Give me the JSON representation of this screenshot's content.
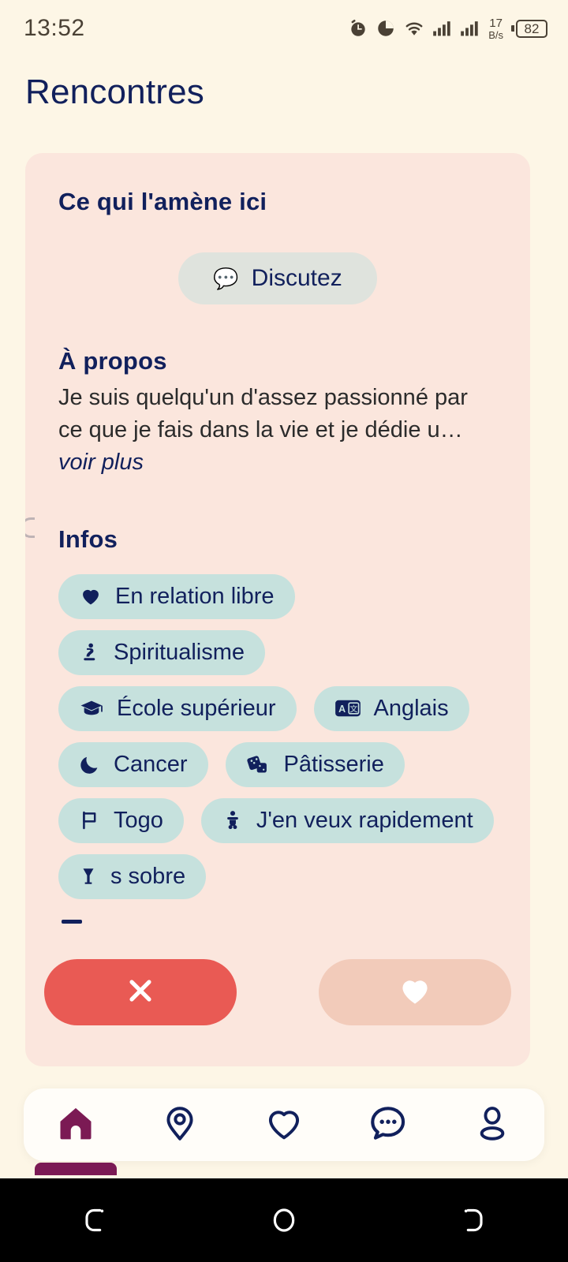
{
  "status_bar": {
    "time": "13:52",
    "network_speed_value": "17",
    "network_speed_unit": "B/s",
    "battery_level": "82",
    "icons": [
      "alarm-icon",
      "pie-chart-icon",
      "wifi-icon",
      "signal-bars-icon",
      "signal-bars-icon",
      "battery-icon"
    ]
  },
  "header": {
    "title": "Rencontres"
  },
  "card": {
    "intent": {
      "heading": "Ce qui l'amène ici",
      "chip": {
        "emoji": "💬",
        "label": "Discutez"
      }
    },
    "about": {
      "heading": "À propos",
      "text": "Je suis quelqu'un d'assez passionné par ce que je fais dans la vie et je dédie u…",
      "see_more": "voir plus"
    },
    "infos": {
      "heading": "Infos",
      "chips": [
        {
          "icon": "heart-icon",
          "label": "En relation libre"
        },
        {
          "icon": "praying-person-icon",
          "label": "Spiritualisme"
        },
        {
          "icon": "graduation-cap-icon",
          "label": "École supérieur"
        },
        {
          "icon": "translate-icon",
          "label": "Anglais"
        },
        {
          "icon": "crescent-moon-icon",
          "label": "Cancer"
        },
        {
          "icon": "dice-icon",
          "label": "Pâtisserie"
        },
        {
          "icon": "flag-icon",
          "label": "Togo"
        },
        {
          "icon": "baby-icon",
          "label": "J'en veux rapidement"
        },
        {
          "icon": "glass-icon",
          "label": "s sobre"
        }
      ]
    }
  },
  "actions": {
    "pass": {
      "icon": "close-icon",
      "label": ""
    },
    "like": {
      "icon": "heart-icon",
      "label": ""
    }
  },
  "bottom_nav": {
    "items": [
      {
        "icon": "home-icon",
        "name": "home",
        "active": true
      },
      {
        "icon": "location-pin-icon",
        "name": "explore",
        "active": false
      },
      {
        "icon": "heart-outline-icon",
        "name": "likes",
        "active": false
      },
      {
        "icon": "chat-bubble-icon",
        "name": "messages",
        "active": false
      },
      {
        "icon": "person-icon",
        "name": "profile",
        "active": false
      }
    ]
  },
  "android_nav": {
    "keys": [
      "back-key",
      "home-key",
      "recents-key"
    ]
  },
  "colors": {
    "page_background": "#fdf6e6",
    "card_background": "#fbe6dd",
    "navy": "#11205c",
    "chip_teal": "#c6e1dd",
    "pass_red": "#e95a54",
    "like_peach": "#f2cbba",
    "active_purple": "#7b1a54"
  }
}
